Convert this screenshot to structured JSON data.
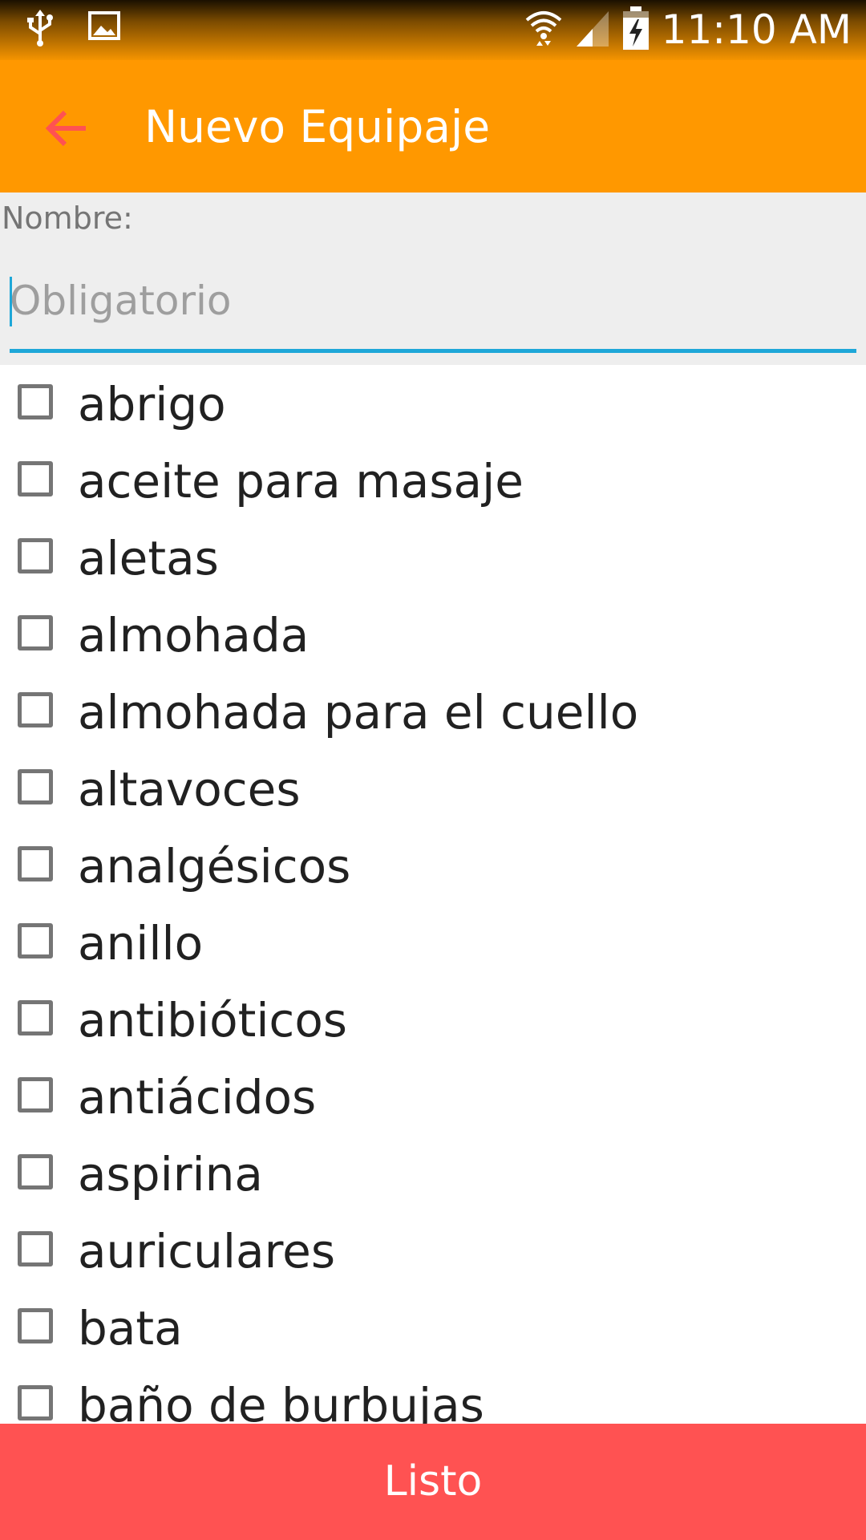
{
  "status_bar": {
    "time": "11:10 AM",
    "icons": [
      "usb-icon",
      "image-icon",
      "wifi-icon",
      "signal-icon",
      "battery-charging-icon"
    ]
  },
  "toolbar": {
    "title": "Nuevo Equipaje",
    "back_icon": "arrow-back-icon"
  },
  "form": {
    "name_label": "Nombre:",
    "name_placeholder": "Obligatorio",
    "name_value": ""
  },
  "items": [
    {
      "label": "abrigo",
      "checked": false
    },
    {
      "label": "aceite para masaje",
      "checked": false
    },
    {
      "label": "aletas",
      "checked": false
    },
    {
      "label": "almohada",
      "checked": false
    },
    {
      "label": "almohada para el cuello",
      "checked": false
    },
    {
      "label": "altavoces",
      "checked": false
    },
    {
      "label": "analgésicos",
      "checked": false
    },
    {
      "label": "anillo",
      "checked": false
    },
    {
      "label": "antibióticos",
      "checked": false
    },
    {
      "label": "antiácidos",
      "checked": false
    },
    {
      "label": "aspirina",
      "checked": false
    },
    {
      "label": "auriculares",
      "checked": false
    },
    {
      "label": "bata",
      "checked": false
    },
    {
      "label": "baño de burbujas",
      "checked": false
    }
  ],
  "footer": {
    "done_label": "Listo"
  },
  "colors": {
    "toolbar": "#ff9800",
    "accent": "#1ea7d8",
    "button": "#ff5252",
    "back_arrow": "#ff5252"
  }
}
